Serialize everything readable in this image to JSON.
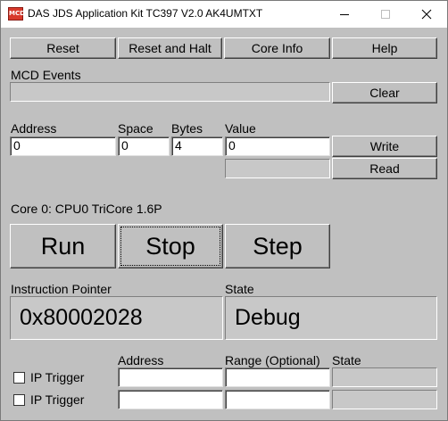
{
  "window": {
    "title": "DAS JDS Application Kit TC397 V2.0 AK4UMTXT",
    "icon_text": "MCD",
    "controls": [
      "minimize-icon",
      "maximize-icon",
      "close-icon"
    ]
  },
  "toolbar": {
    "reset": "Reset",
    "reset_halt": "Reset and Halt",
    "core_info": "Core Info",
    "help": "Help"
  },
  "events": {
    "label": "MCD Events",
    "value": "",
    "clear": "Clear"
  },
  "memory": {
    "address_label": "Address",
    "space_label": "Space",
    "bytes_label": "Bytes",
    "value_label": "Value",
    "address": "0",
    "space": "0",
    "bytes": "4",
    "value": "0",
    "write": "Write",
    "read": "Read",
    "read_result": ""
  },
  "core": {
    "label": "Core 0: CPU0 TriCore 1.6P",
    "run": "Run",
    "stop": "Stop",
    "step": "Step"
  },
  "status": {
    "ip_label": "Instruction Pointer",
    "ip_value": "0x80002028",
    "state_label": "State",
    "state_value": "Debug"
  },
  "triggers": {
    "address_header": "Address",
    "range_header": "Range (Optional)",
    "state_header": "State",
    "rows": [
      {
        "label": "IP Trigger",
        "checked": false,
        "address": "",
        "range": "",
        "state": ""
      },
      {
        "label": "IP Trigger",
        "checked": false,
        "address": "",
        "range": "",
        "state": ""
      }
    ]
  },
  "colors": {
    "background": "#c0c0c0",
    "icon_red": "#d83a2c"
  }
}
